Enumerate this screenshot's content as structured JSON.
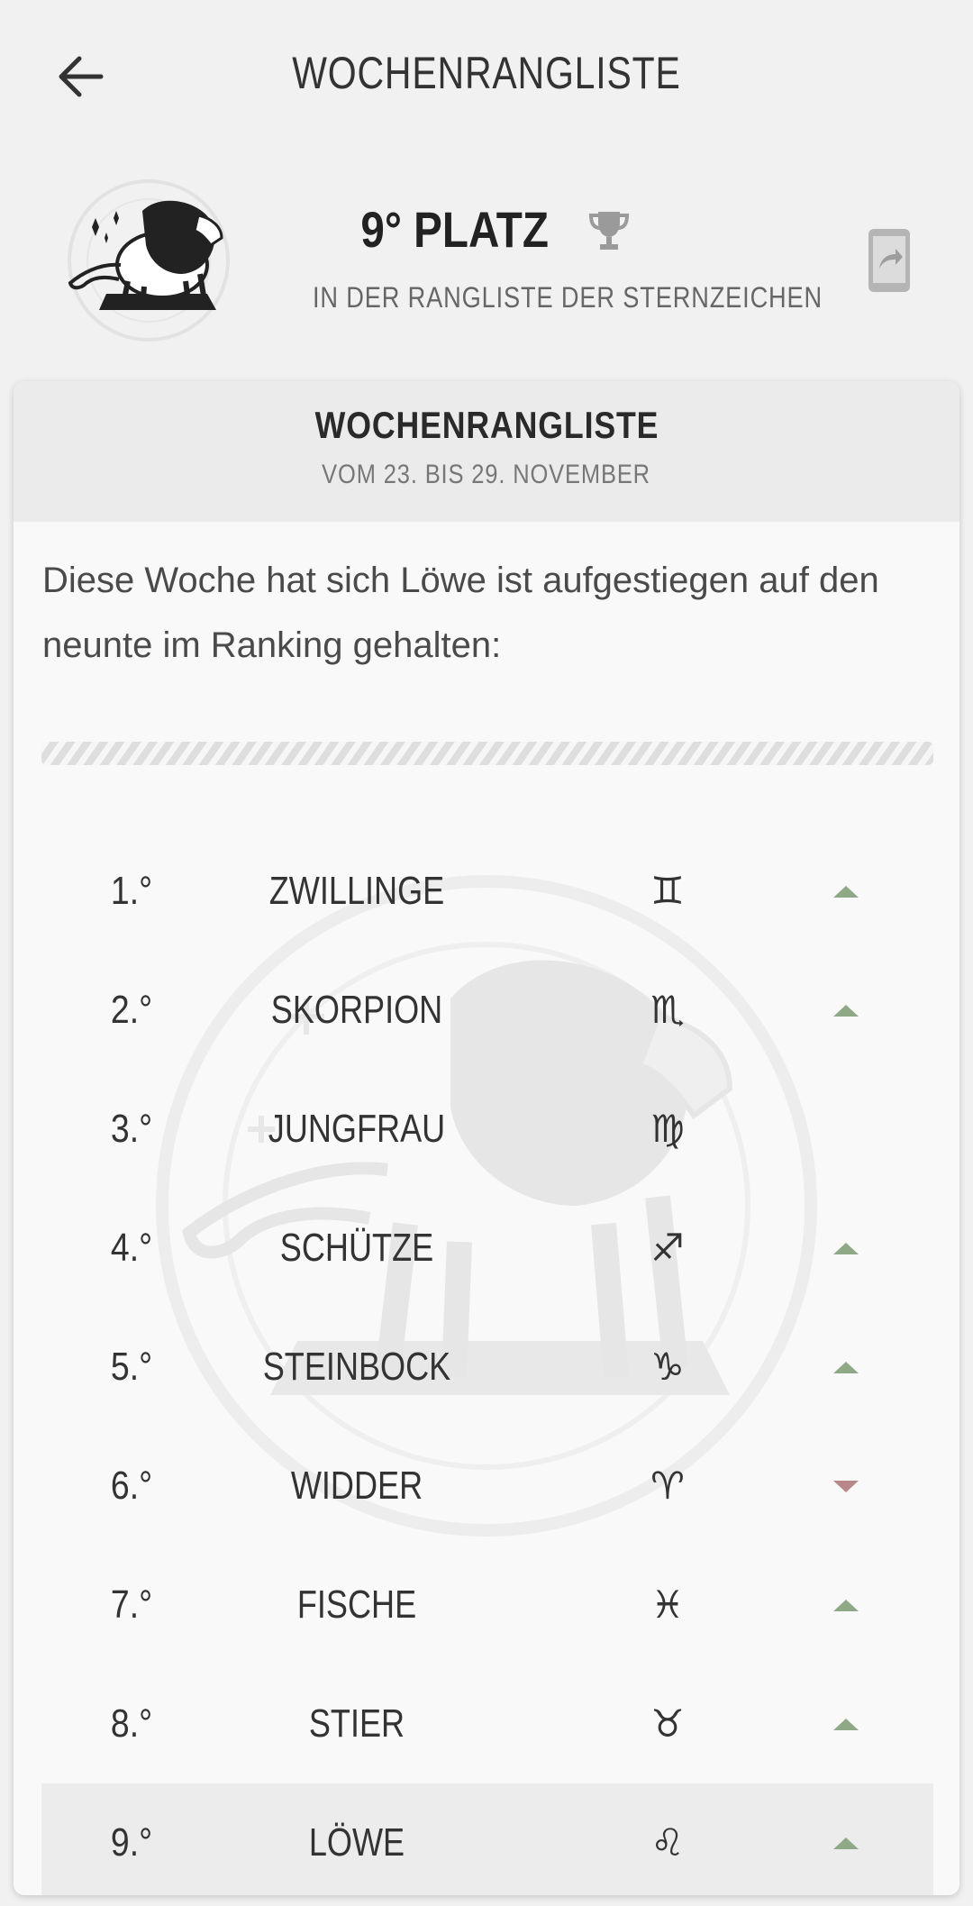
{
  "header": {
    "title": "WOCHENRANGLISTE"
  },
  "hero": {
    "rank_label": "9° PLATZ",
    "subtitle": "IN DER RANGLISTE DER STERNZEICHEN",
    "avatar_icon": "lion-leo-icon",
    "trophy_icon": "trophy-icon",
    "share_icon": "share-icon"
  },
  "card": {
    "title": "WOCHENRANGLISTE",
    "date_range": "VOM 23. BIS 29. NOVEMBER",
    "intro_text": "Diese Woche hat sich Löwe ist aufgestiegen auf den neunte im Ranking gehalten:"
  },
  "colors": {
    "up": "#8fa987",
    "down": "#b8878a",
    "highlight": "#ececec"
  },
  "rankings": [
    {
      "pos": "1.°",
      "name": "ZWILLINGE",
      "glyph": "♊",
      "trend": "up"
    },
    {
      "pos": "2.°",
      "name": "SKORPION",
      "glyph": "♏",
      "trend": "up"
    },
    {
      "pos": "3.°",
      "name": "JUNGFRAU",
      "glyph": "♍",
      "trend": "none"
    },
    {
      "pos": "4.°",
      "name": "SCHÜTZE",
      "glyph": "♐",
      "trend": "up"
    },
    {
      "pos": "5.°",
      "name": "STEINBOCK",
      "glyph": "♑",
      "trend": "up"
    },
    {
      "pos": "6.°",
      "name": "WIDDER",
      "glyph": "♈",
      "trend": "down"
    },
    {
      "pos": "7.°",
      "name": "FISCHE",
      "glyph": "♓",
      "trend": "up"
    },
    {
      "pos": "8.°",
      "name": "STIER",
      "glyph": "♉",
      "trend": "up"
    },
    {
      "pos": "9.°",
      "name": "LÖWE",
      "glyph": "♌",
      "trend": "up",
      "highlight": true
    }
  ]
}
